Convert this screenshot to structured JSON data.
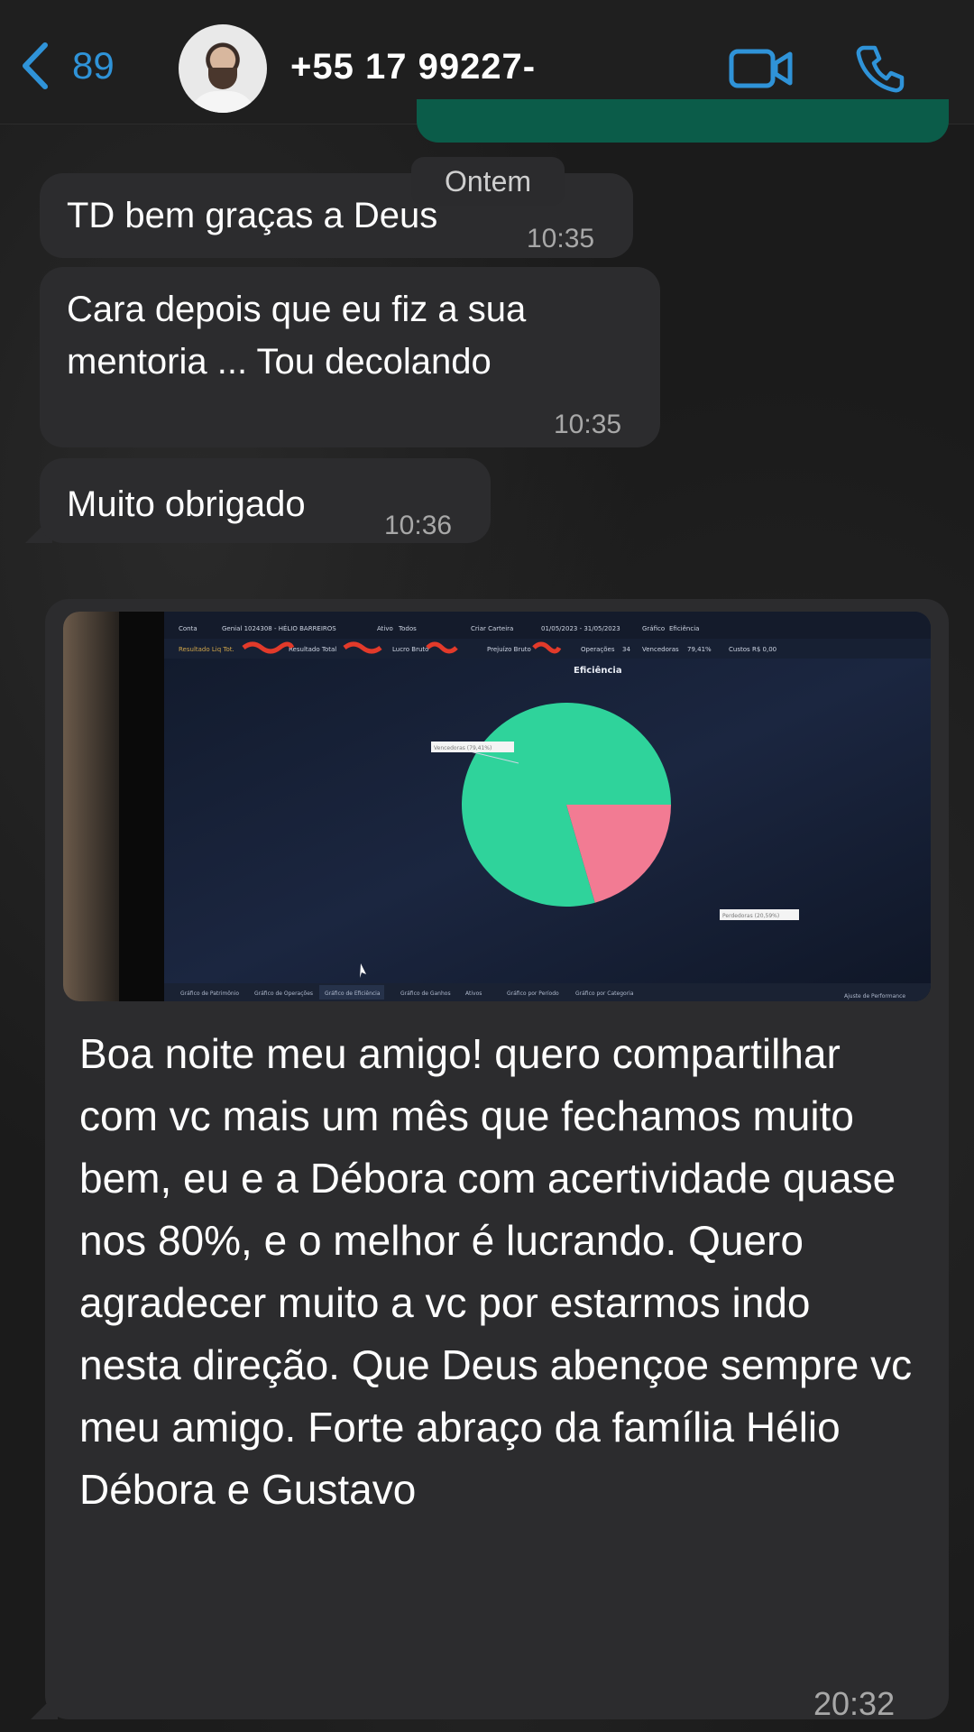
{
  "header": {
    "back_count": "89",
    "contact_title": "+55 17 99227-",
    "video_icon": "video-call-icon",
    "phone_icon": "phone-call-icon",
    "accent_color": "#2f93d8"
  },
  "day_separator": "Ontem",
  "messages": [
    {
      "text": "TD bem graças a Deus",
      "time": "10:35"
    },
    {
      "text": "Cara depois que eu fiz a sua mentoria ... Tou decolando",
      "time": "10:35"
    },
    {
      "text": "Muito obrigado",
      "time": "10:36"
    },
    {
      "text": "Boa noite meu amigo! quero compartilhar com vc mais um mês que fechamos muito bem, eu e a Débora com acertividade quase nos 80%, e o melhor é lucrando. Quero agradecer muito a vc por estarmos indo nesta direção. Que Deus abençoe sempre vc meu amigo. Forte abraço da família Hélio Débora e Gustavo",
      "time": "20:32"
    }
  ],
  "photo": {
    "toolbar": {
      "conta_label": "Conta",
      "account": "Genial 1024308 - HÉLIO BARREIROS",
      "ativo_label": "Ativo",
      "ativo_value": "Todos",
      "carteira": "Criar Carteira",
      "period": "01/05/2023 - 31/05/2023",
      "grafico_label": "Gráfico",
      "grafico_value": "Eficiência"
    },
    "stats": {
      "resultado_liq": "Resultado Liq Tot.",
      "resultado_total": "Resultado Total",
      "lucro_bruto": "Lucro Bruto",
      "prejuizo_bruto": "Prejuízo Bruto",
      "operacoes_label": "Operações",
      "operacoes_value": "34",
      "vencedoras_label": "Vencedoras",
      "vencedoras_value": "79,41%",
      "custos_label": "Custos",
      "custos_value": "R$ 0,00"
    },
    "chart_title": "Eficiência",
    "tabs": [
      "Gráfico de Patrimônio",
      "Gráfico de Operações",
      "Gráfico de Eficiência",
      "Gráfico de Ganhos",
      "Ativos",
      "Gráfico por Período",
      "Gráfico por Categoria"
    ],
    "corner_label": "Ajuste de Performance",
    "label_vencedoras": "Vencedoras (79,41%)",
    "label_perdedoras": "Perdedoras (20,59%)"
  },
  "chart_data": {
    "type": "pie",
    "title": "Eficiência",
    "categories": [
      "Vencedoras",
      "Perdedoras"
    ],
    "values": [
      79.41,
      20.59
    ],
    "colors": [
      "#2fd39b",
      "#f27b93"
    ]
  }
}
